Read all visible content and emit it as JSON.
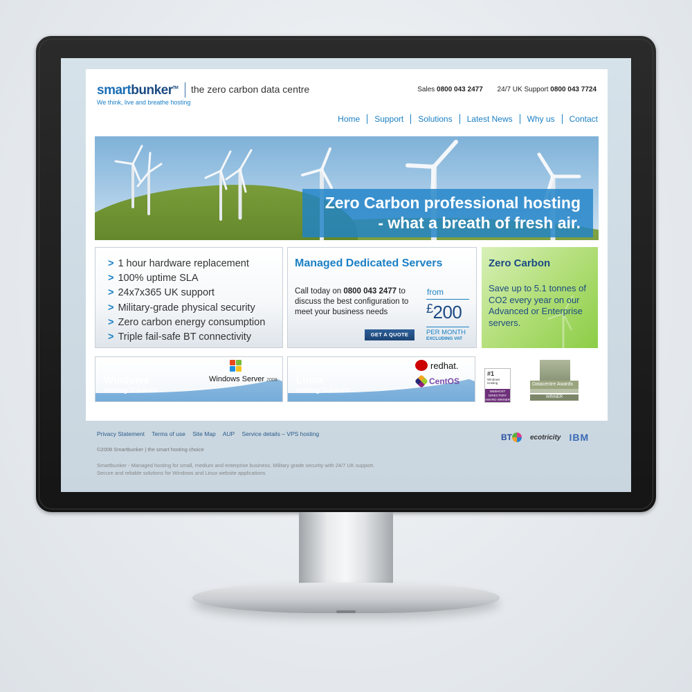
{
  "header": {
    "logo_main": "smart",
    "logo_dark": "bunker",
    "logo_tm": "TM",
    "tagline": "the zero carbon data centre",
    "subtagline": "We think, live and breathe hosting",
    "sales_label": "Sales",
    "sales_phone": "0800 043 2477",
    "support_label": "24/7 UK Support",
    "support_phone": "0800 043 7724"
  },
  "nav": {
    "items": [
      "Home",
      "Support",
      "Solutions",
      "Latest News",
      "Why us",
      "Contact"
    ]
  },
  "hero": {
    "line1": "Zero Carbon professional hosting",
    "line2": "- what a breath of fresh air."
  },
  "features": {
    "items": [
      "1 hour hardware replacement",
      "100% uptime SLA",
      "24x7x365 UK support",
      "Military-grade physical security",
      "Zero carbon energy consumption",
      "Triple fail-safe BT connectivity"
    ]
  },
  "dedicated": {
    "title": "Managed Dedicated Servers",
    "body_pre": "Call today on ",
    "body_phone": "0800 043 2477",
    "body_post": " to discuss the best configuration to meet your business needs",
    "from": "from",
    "currency": "£",
    "price": "200",
    "per_month": "PER MONTH",
    "excluding": "EXCLUDING VAT",
    "button": "GET A QUOTE"
  },
  "zero_carbon": {
    "title": "Zero Carbon",
    "body": "Save up to 5.1 tonnes of CO2 every year on our Advanced or Enterprise servers."
  },
  "banners": {
    "windows_title": "Windows",
    "windows_sub": "Hosting Solutions",
    "windows_logo": "Windows Server",
    "windows_year": "2008",
    "linux_title": "Linux",
    "linux_sub": "Hosting Solutions",
    "redhat": "redhat.",
    "centos": "CentOS"
  },
  "awards": {
    "award1_rank": "#1",
    "award1_text": "Windows Hosting",
    "award1_badge": "WEBHOST DIRECTORY AWARD WINNER",
    "award2_title": "Datacentre Awards",
    "award2_winner": "WINNER"
  },
  "footer": {
    "links": [
      "Privacy Statement",
      "Terms of use",
      "Site Map",
      "AUP",
      "Service details – VPS hosting"
    ],
    "copyright": "©2008 Smartbunker | the smart hosting choice",
    "about_line1": "Smartbunker - Managed hosting for small, medium and enterprise business. Military grade security with 24/7 UK support.",
    "about_line2": "Secure and reliable solutions for Windows and Linux website applications",
    "partner_bt": "BT",
    "partner_ecotricity": "ecotricity",
    "partner_ibm": "IBM"
  },
  "colors": {
    "brand_blue": "#1a7fc4",
    "brand_navy": "#1c4a82",
    "green_panel": "#8ccd46",
    "button_navy": "#1c4374"
  }
}
